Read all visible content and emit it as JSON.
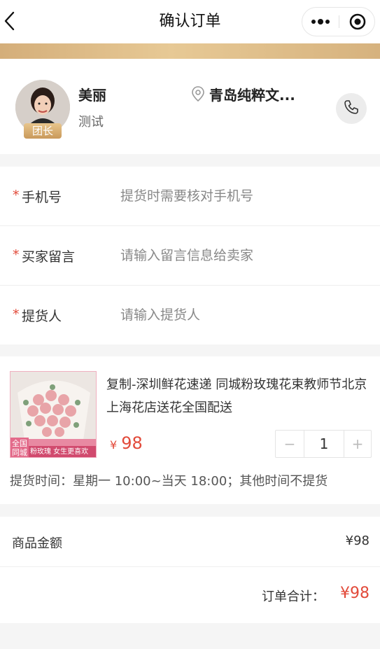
{
  "nav": {
    "title": "确认订单",
    "back_icon": "chevron-left-icon",
    "more_icon": "more-dots-icon",
    "close_icon": "target-circle-icon"
  },
  "leader": {
    "name": "美丽",
    "subtitle": "测试",
    "badge": "团长",
    "location": "青岛纯粹文...",
    "location_icon": "location-pin-icon",
    "phone_icon": "phone-icon"
  },
  "form": {
    "fields": [
      {
        "required_mark": "*",
        "label": "手机号",
        "placeholder": "提货时需要核对手机号"
      },
      {
        "required_mark": "*",
        "label": "买家留言",
        "placeholder": "请输入留言信息给卖家"
      },
      {
        "required_mark": "*",
        "label": "提货人",
        "placeholder": "请输入提货人"
      }
    ]
  },
  "product": {
    "title": "复制-深圳鲜花速递 同城粉玫瑰花束教师节北京上海花店送花全国配送",
    "price_symbol": "¥",
    "price": "98",
    "quantity": "1",
    "minus_label": "−",
    "plus_label": "+",
    "pickup_time": "提货时间：星期一 10:00~当天 18:00；其他时间不提货",
    "image": {
      "tag_line1": "全国",
      "tag_line2": "同城",
      "banner_text": "粉玫瑰 女生更喜欢"
    }
  },
  "totals": {
    "goods_label": "商品金额",
    "goods_value": "¥98",
    "order_label": "订单合计：",
    "order_value": "¥98"
  },
  "colors": {
    "accent_red": "#e24a3a",
    "gold": "#d8b27e"
  }
}
